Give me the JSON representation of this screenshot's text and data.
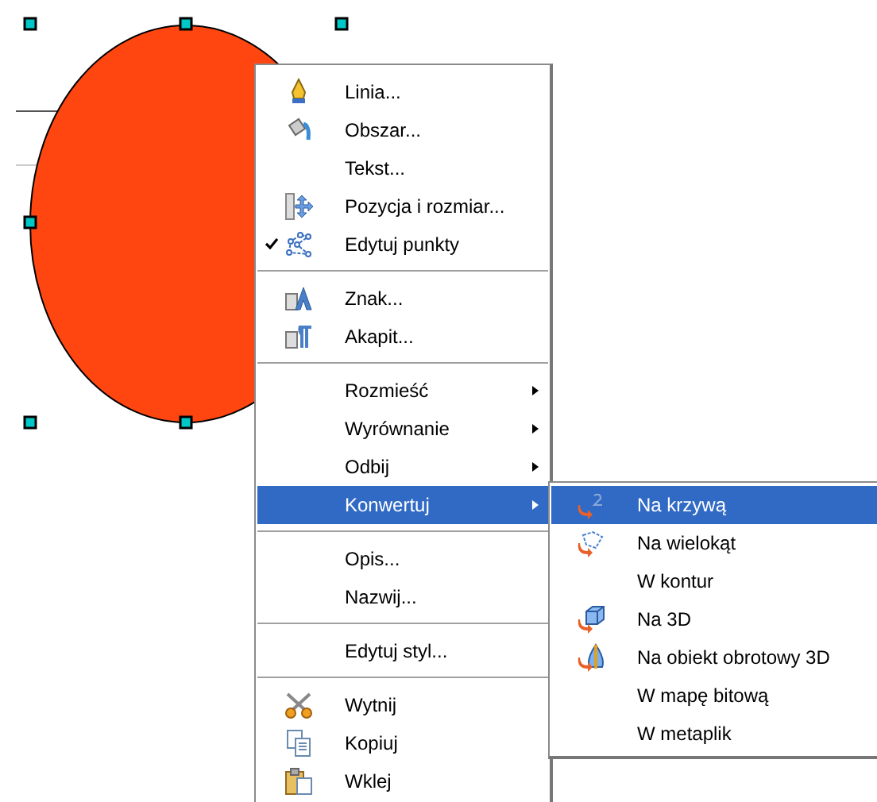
{
  "context_menu": {
    "groups": [
      [
        {
          "label": "Linia...",
          "checked": false,
          "submenu": false,
          "selected": false
        },
        {
          "label": "Obszar...",
          "checked": false,
          "submenu": false,
          "selected": false
        },
        {
          "label": "Tekst...",
          "checked": false,
          "submenu": false,
          "selected": false
        },
        {
          "label": "Pozycja i rozmiar...",
          "checked": false,
          "submenu": false,
          "selected": false
        },
        {
          "label": "Edytuj punkty",
          "checked": true,
          "submenu": false,
          "selected": false
        }
      ],
      [
        {
          "label": "Znak...",
          "checked": false,
          "submenu": false,
          "selected": false
        },
        {
          "label": "Akapit...",
          "checked": false,
          "submenu": false,
          "selected": false
        }
      ],
      [
        {
          "label": "Rozmieść",
          "checked": false,
          "submenu": true,
          "selected": false
        },
        {
          "label": "Wyrównanie",
          "checked": false,
          "submenu": true,
          "selected": false
        },
        {
          "label": "Odbij",
          "checked": false,
          "submenu": true,
          "selected": false
        },
        {
          "label": "Konwertuj",
          "checked": false,
          "submenu": true,
          "selected": true
        }
      ],
      [
        {
          "label": "Opis...",
          "checked": false,
          "submenu": false,
          "selected": false
        },
        {
          "label": "Nazwij...",
          "checked": false,
          "submenu": false,
          "selected": false
        }
      ],
      [
        {
          "label": "Edytuj styl...",
          "checked": false,
          "submenu": false,
          "selected": false
        }
      ],
      [
        {
          "label": "Wytnij",
          "checked": false,
          "submenu": false,
          "selected": false
        },
        {
          "label": "Kopiuj",
          "checked": false,
          "submenu": false,
          "selected": false
        },
        {
          "label": "Wklej",
          "checked": false,
          "submenu": false,
          "selected": false
        }
      ]
    ]
  },
  "submenu": {
    "items": [
      {
        "label": "Na krzywą",
        "selected": true
      },
      {
        "label": "Na wielokąt",
        "selected": false
      },
      {
        "label": "W kontur",
        "selected": false
      },
      {
        "label": "Na 3D",
        "selected": false
      },
      {
        "label": "Na obiekt obrotowy 3D",
        "selected": false
      },
      {
        "label": "W mapę bitową",
        "selected": false
      },
      {
        "label": "W metaplik",
        "selected": false
      }
    ]
  }
}
